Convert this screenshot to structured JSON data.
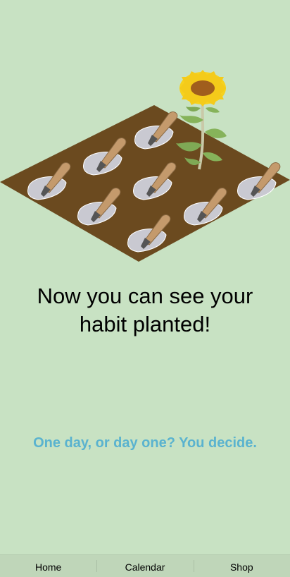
{
  "onboarding": {
    "headline_line1": "Now you can see your",
    "headline_line2": "habit planted!",
    "tagline": "One day, or day one? You decide."
  },
  "tabbar": {
    "home": "Home",
    "calendar": "Calendar",
    "shop": "Shop"
  },
  "colors": {
    "background": "#c8e2c3",
    "soil": "#6b4a1f",
    "accent_text": "#5ab3cf",
    "tabbar": "#bfd6b9"
  },
  "illustration": {
    "soil_icon": "soil-plot-icon",
    "trowel_icon": "trowel-icon",
    "flower_icon": "sunflower-icon",
    "planted_spots": 9
  }
}
